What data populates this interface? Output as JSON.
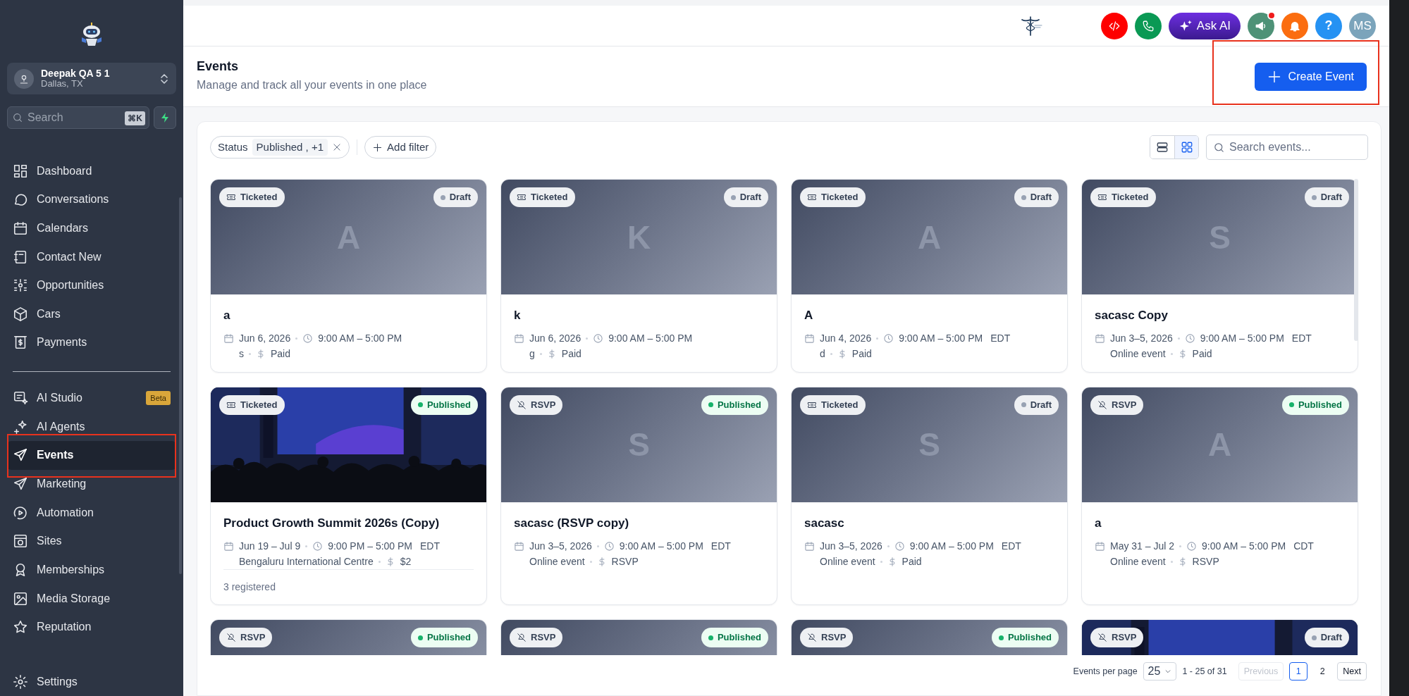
{
  "sidebar": {
    "account": {
      "name": "Deepak QA 5 1",
      "location": "Dallas, TX"
    },
    "search": {
      "placeholder": "Search",
      "shortcut": "⌘K"
    },
    "sections": [
      {
        "items": [
          {
            "label": "Dashboard",
            "selected": false,
            "highlighted": false
          },
          {
            "label": "Conversations",
            "selected": false,
            "highlighted": false
          },
          {
            "label": "Calendars",
            "selected": false,
            "highlighted": false
          },
          {
            "label": "Contact New",
            "selected": false,
            "highlighted": false
          },
          {
            "label": "Opportunities",
            "selected": false,
            "highlighted": false
          },
          {
            "label": "Cars",
            "selected": false,
            "highlighted": false
          },
          {
            "label": "Payments",
            "selected": false,
            "highlighted": false
          }
        ]
      },
      {
        "items": [
          {
            "label": "AI Studio",
            "selected": false,
            "highlighted": false,
            "badge": "Beta"
          },
          {
            "label": "AI Agents",
            "selected": false,
            "highlighted": false
          },
          {
            "label": "Events",
            "selected": true,
            "highlighted": true
          },
          {
            "label": "Marketing",
            "selected": false,
            "highlighted": false
          },
          {
            "label": "Automation",
            "selected": false,
            "highlighted": false
          },
          {
            "label": "Sites",
            "selected": false,
            "highlighted": false
          },
          {
            "label": "Memberships",
            "selected": false,
            "highlighted": false
          },
          {
            "label": "Media Storage",
            "selected": false,
            "highlighted": false
          },
          {
            "label": "Reputation",
            "selected": false,
            "highlighted": false
          }
        ]
      }
    ],
    "footer_item": {
      "label": "Settings",
      "selected": false,
      "highlighted": false
    }
  },
  "topbar": {
    "ask_ai": "Ask AI",
    "announcements_alert": true,
    "help": "?",
    "avatar": "MS"
  },
  "header": {
    "title": "Events",
    "subtitle": "Manage and track all your events in one place",
    "create_button": {
      "label": "Create Event",
      "highlighted": true
    }
  },
  "toolbar": {
    "filters": [
      {
        "field": "Status",
        "value": "Published , +1"
      }
    ],
    "add_filter": "Add filter",
    "views": [
      {
        "kind": "list",
        "selected": false
      },
      {
        "kind": "grid",
        "selected": true
      }
    ],
    "search": {
      "placeholder": "Search events..."
    }
  },
  "events": [
    {
      "rsvp": false,
      "type_label": "Ticketed",
      "published": false,
      "status_label": "Draft",
      "initial": "A",
      "title": "a",
      "date": "Jun 6, 2026",
      "time": "9:00 AM – 5:00 PM",
      "location": "s",
      "price": "Paid"
    },
    {
      "rsvp": false,
      "type_label": "Ticketed",
      "published": false,
      "status_label": "Draft",
      "initial": "K",
      "title": "k",
      "date": "Jun 6, 2026",
      "time": "9:00 AM – 5:00 PM",
      "location": "g",
      "price": "Paid"
    },
    {
      "rsvp": false,
      "type_label": "Ticketed",
      "published": false,
      "status_label": "Draft",
      "initial": "A",
      "title": "A",
      "date": "Jun 4, 2026",
      "time": "9:00 AM – 5:00 PM",
      "timezone": "EDT",
      "location": "d",
      "price": "Paid"
    },
    {
      "rsvp": false,
      "type_label": "Ticketed",
      "published": false,
      "status_label": "Draft",
      "initial": "S",
      "title": "sacasc Copy",
      "date": "Jun 3–5, 2026",
      "time": "9:00 AM – 5:00 PM",
      "timezone": "EDT",
      "location": "Online event",
      "price": "Paid"
    },
    {
      "rsvp": false,
      "type_label": "Ticketed",
      "published": true,
      "status_label": "Published",
      "kind": "picture",
      "title": "Product Growth Summit 2026s (Copy)",
      "date": "Jun 19 – Jul 9",
      "time": "9:00 PM – 5:00 PM",
      "timezone": "EDT",
      "location": "Bengaluru International Centre",
      "price": "$2",
      "registered": "3 registered"
    },
    {
      "rsvp": true,
      "type_label": "RSVP",
      "published": true,
      "status_label": "Published",
      "initial": "S",
      "title": "sacasc (RSVP copy)",
      "date": "Jun 3–5, 2026",
      "time": "9:00 AM – 5:00 PM",
      "timezone": "EDT",
      "location": "Online event",
      "price": "RSVP"
    },
    {
      "rsvp": false,
      "type_label": "Ticketed",
      "published": false,
      "status_label": "Draft",
      "initial": "S",
      "title": "sacasc",
      "date": "Jun 3–5, 2026",
      "time": "9:00 AM – 5:00 PM",
      "timezone": "EDT",
      "location": "Online event",
      "price": "Paid"
    },
    {
      "rsvp": true,
      "type_label": "RSVP",
      "published": true,
      "status_label": "Published",
      "initial": "A",
      "title": "a",
      "date": "May 31 – Jul 2",
      "time": "9:00 AM – 5:00 PM",
      "timezone": "CDT",
      "location": "Online event",
      "price": "RSVP"
    },
    {
      "rsvp": true,
      "type_label": "RSVP",
      "published": true,
      "status_label": "Published"
    },
    {
      "rsvp": true,
      "type_label": "RSVP",
      "published": true,
      "status_label": "Published"
    },
    {
      "rsvp": true,
      "type_label": "RSVP",
      "published": true,
      "status_label": "Published"
    },
    {
      "rsvp": true,
      "type_label": "RSVP",
      "published": false,
      "status_label": "Draft",
      "kind": "picture"
    }
  ],
  "pagination": {
    "per_page_label": "Events per page",
    "per_page": "25",
    "range": "1 - 25 of 31",
    "previous": {
      "label": "Previous",
      "disabled": true
    },
    "pages": [
      {
        "label": "1",
        "selected": true
      },
      {
        "label": "2",
        "selected": false
      }
    ],
    "next": {
      "label": "Next",
      "disabled": false
    }
  }
}
